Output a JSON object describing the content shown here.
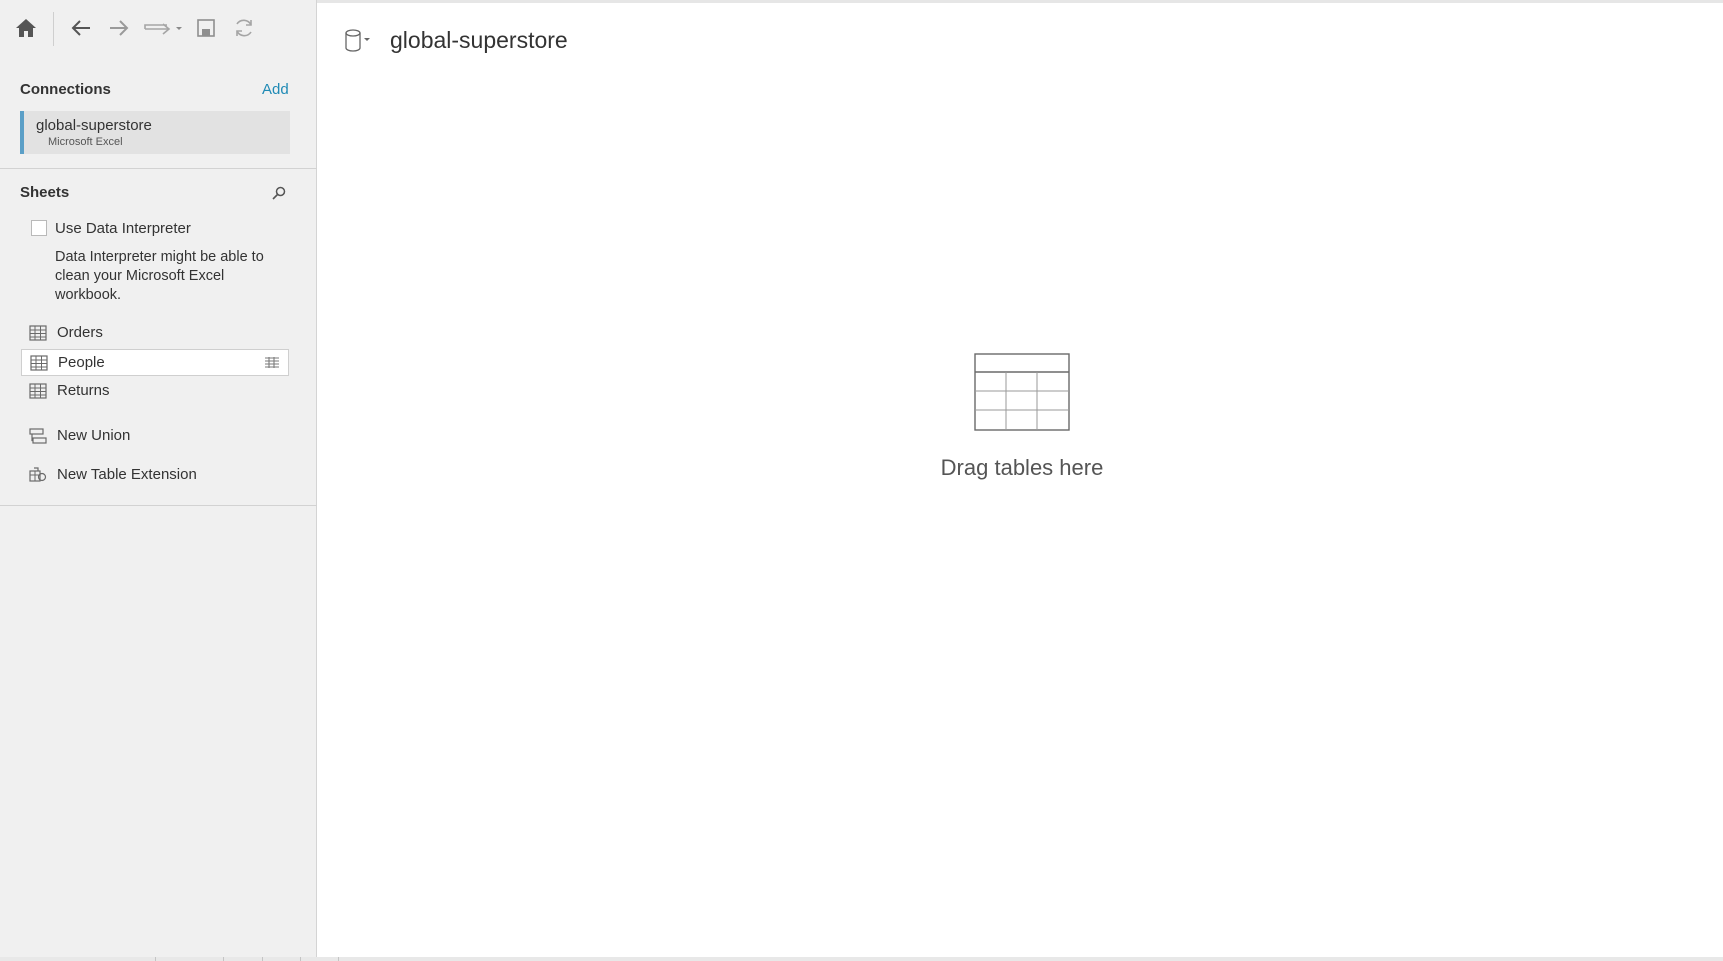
{
  "toolbar": {
    "icons": [
      "home-icon",
      "back-icon",
      "forward-icon",
      "redo-dropdown-icon",
      "save-icon",
      "refresh-icon"
    ]
  },
  "connections": {
    "title": "Connections",
    "add_label": "Add",
    "items": [
      {
        "name": "global-superstore",
        "type": "Microsoft Excel"
      }
    ],
    "accent_color": "#5b9fc7"
  },
  "sheets": {
    "title": "Sheets",
    "interpreter_label": "Use Data Interpreter",
    "interpreter_checked": false,
    "interpreter_help": "Data Interpreter might be able to clean your Microsoft Excel workbook.",
    "items": [
      {
        "label": "Orders",
        "icon": "table-icon",
        "selected": false
      },
      {
        "label": "People",
        "icon": "table-icon",
        "selected": true
      },
      {
        "label": "Returns",
        "icon": "table-icon",
        "selected": false
      }
    ],
    "extras": [
      {
        "label": "New Union",
        "icon": "union-icon"
      },
      {
        "label": "New Table Extension",
        "icon": "table-extension-icon"
      }
    ]
  },
  "canvas": {
    "datasource_title": "global-superstore",
    "drop_hint": "Drag tables here"
  }
}
